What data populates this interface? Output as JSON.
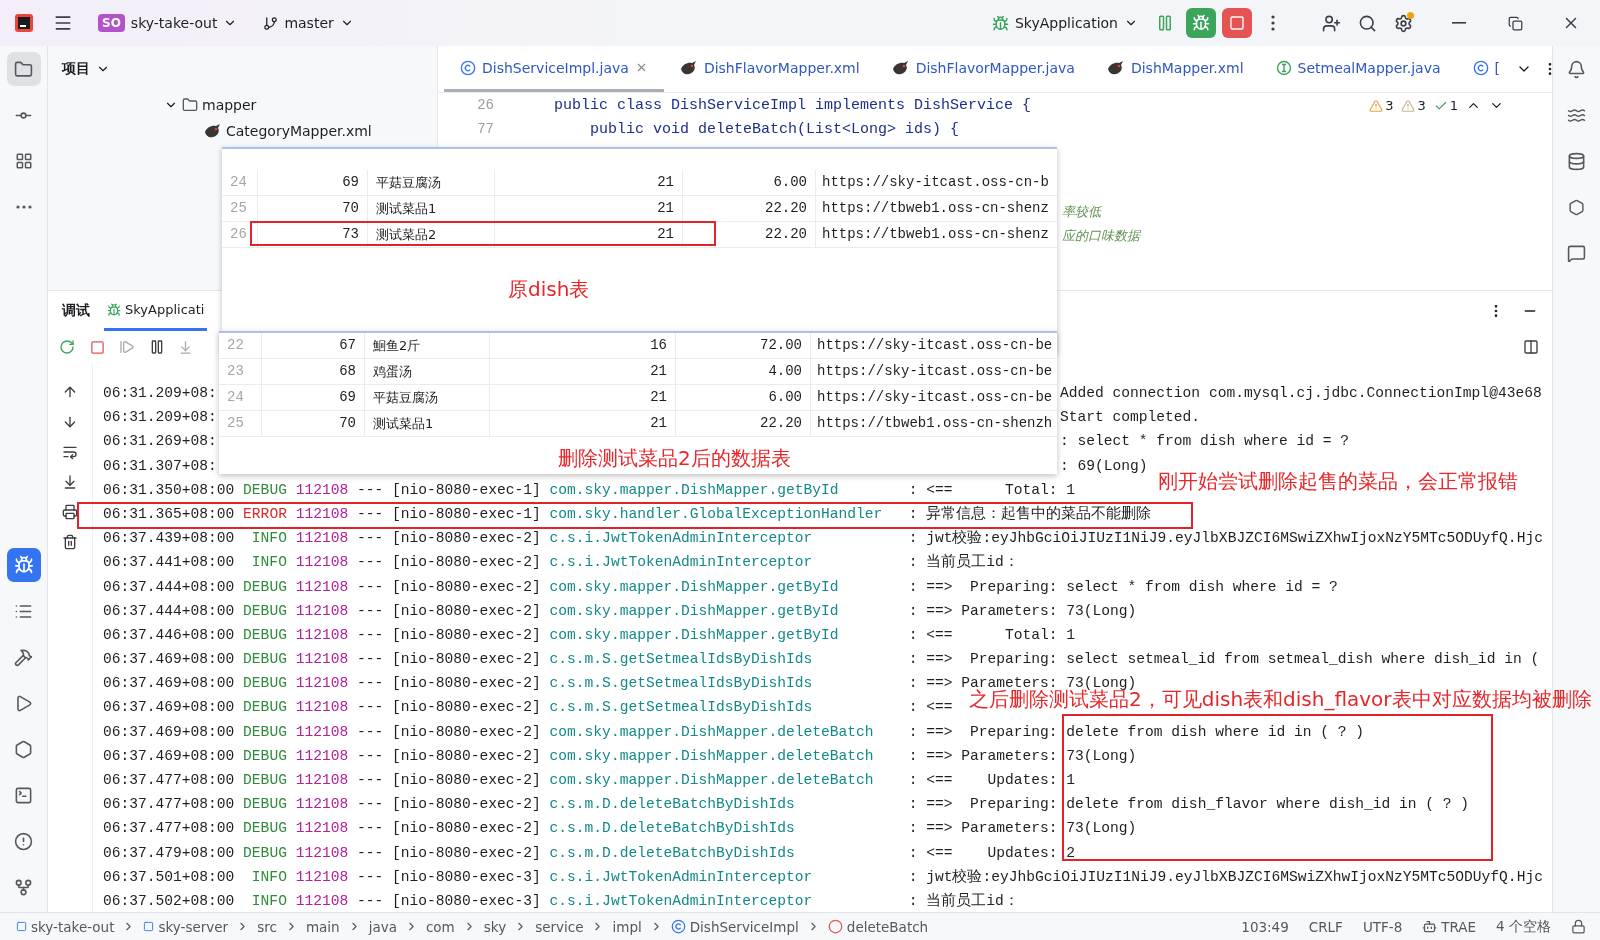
{
  "title_bar": {
    "project_badge": "SO",
    "project": "sky-take-out",
    "branch": "master",
    "run_config": "SkyApplication"
  },
  "project_panel": {
    "title": "项目",
    "tree": [
      {
        "label": "mapper",
        "expanded": true,
        "children": [
          {
            "label": "CategoryMapper.xml"
          }
        ]
      }
    ]
  },
  "editor": {
    "tabs": [
      {
        "label": "DishServiceImpl.java",
        "kind": "class",
        "selected": true
      },
      {
        "label": "DishFlavorMapper.xml",
        "kind": "xml",
        "selected": false
      },
      {
        "label": "DishFlavorMapper.java",
        "kind": "xml",
        "selected": false
      },
      {
        "label": "DishMapper.xml",
        "kind": "xml",
        "selected": false
      },
      {
        "label": "SetmealMapper.java",
        "kind": "interface",
        "selected": false
      },
      {
        "label": "[",
        "kind": "class",
        "selected": false
      }
    ],
    "inspections": [
      {
        "kind": "warning",
        "count": "3"
      },
      {
        "kind": "weak",
        "count": "3"
      },
      {
        "kind": "ok",
        "count": "1"
      }
    ],
    "lines": [
      {
        "number": "26",
        "code": "public class DishServiceImpl implements DishService {"
      },
      {
        "number": "77",
        "code": "    public void deleteBatch(List<Long> ids) {"
      }
    ],
    "comment_fragments": [
      "率较低",
      "应的口味数据"
    ]
  },
  "debug_panel": {
    "title": "调试",
    "tabs": [
      {
        "label": "SkyApplicati",
        "selected": true
      }
    ],
    "log": [
      {
        "kind": "partial",
        "time": "06:31.209+08:",
        "message": "Added connection com.mysql.cj.jdbc.ConnectionImpl@43e68"
      },
      {
        "kind": "partial",
        "time": "06:31.209+08:",
        "message": "Start completed."
      },
      {
        "kind": "partial",
        "time": "06:31.269+08:",
        "message": ": select * from dish where id = ?"
      },
      {
        "kind": "partial",
        "time": "06:31.307+08:",
        "message": ": 69(Long)"
      },
      {
        "kind": "full",
        "time": "06:31.350+08:00",
        "severity": "DEBUG",
        "color": "#2f8a3c",
        "pid": "112108",
        "thread": "--- [nio-8080-exec-1]",
        "logger": "com.sky.mapper.DishMapper.getById",
        "message": ": <==      Total: 1"
      },
      {
        "kind": "full",
        "time": "06:31.365+08:00",
        "severity": "ERROR",
        "color": "#e0282c",
        "pid": "112108",
        "thread": "--- [nio-8080-exec-1]",
        "logger": "com.sky.handler.GlobalExceptionHandler",
        "message": ": 异常信息：起售中的菜品不能删除"
      },
      {
        "kind": "full",
        "time": "06:37.439+08:00",
        "severity": "INFO",
        "color": "#2f8a3c",
        "pid": "112108",
        "thread": "--- [nio-8080-exec-2]",
        "logger": "c.s.i.JwtTokenAdminInterceptor",
        "message": ": jwt校验:eyJhbGciOiJIUzI1NiJ9.eyJlbXBJZCI6MSwiZXhwIjoxNzY5MTc5ODUyfQ.Hjc"
      },
      {
        "kind": "full",
        "time": "06:37.441+08:00",
        "severity": "INFO",
        "color": "#2f8a3c",
        "pid": "112108",
        "thread": "--- [nio-8080-exec-2]",
        "logger": "c.s.i.JwtTokenAdminInterceptor",
        "message": ": 当前员工id："
      },
      {
        "kind": "full",
        "time": "06:37.444+08:00",
        "severity": "DEBUG",
        "color": "#2f8a3c",
        "pid": "112108",
        "thread": "--- [nio-8080-exec-2]",
        "logger": "com.sky.mapper.DishMapper.getById",
        "message": ": ==>  Preparing: select * from dish where id = ?"
      },
      {
        "kind": "full",
        "time": "06:37.444+08:00",
        "severity": "DEBUG",
        "color": "#2f8a3c",
        "pid": "112108",
        "thread": "--- [nio-8080-exec-2]",
        "logger": "com.sky.mapper.DishMapper.getById",
        "message": ": ==> Parameters: 73(Long)"
      },
      {
        "kind": "full",
        "time": "06:37.446+08:00",
        "severity": "DEBUG",
        "color": "#2f8a3c",
        "pid": "112108",
        "thread": "--- [nio-8080-exec-2]",
        "logger": "com.sky.mapper.DishMapper.getById",
        "message": ": <==      Total: 1"
      },
      {
        "kind": "full",
        "time": "06:37.469+08:00",
        "severity": "DEBUG",
        "color": "#2f8a3c",
        "pid": "112108",
        "thread": "--- [nio-8080-exec-2]",
        "logger": "c.s.m.S.getSetmealIdsByDishIds",
        "message": ": ==>  Preparing: select setmeal_id from setmeal_dish where dish_id in ("
      },
      {
        "kind": "full",
        "time": "06:37.469+08:00",
        "severity": "DEBUG",
        "color": "#2f8a3c",
        "pid": "112108",
        "thread": "--- [nio-8080-exec-2]",
        "logger": "c.s.m.S.getSetmealIdsByDishIds",
        "message": ": ==> Parameters: 73(Long)"
      },
      {
        "kind": "full",
        "time": "06:37.469+08:00",
        "severity": "DEBUG",
        "color": "#2f8a3c",
        "pid": "112108",
        "thread": "--- [nio-8080-exec-2]",
        "logger": "c.s.m.S.getSetmealIdsByDishIds",
        "message": ": <=="
      },
      {
        "kind": "full",
        "time": "06:37.469+08:00",
        "severity": "DEBUG",
        "color": "#2f8a3c",
        "pid": "112108",
        "thread": "--- [nio-8080-exec-2]",
        "logger": "com.sky.mapper.DishMapper.deleteBatch",
        "message": ": ==>  Preparing: delete from dish where id in ( ? )"
      },
      {
        "kind": "full",
        "time": "06:37.469+08:00",
        "severity": "DEBUG",
        "color": "#2f8a3c",
        "pid": "112108",
        "thread": "--- [nio-8080-exec-2]",
        "logger": "com.sky.mapper.DishMapper.deleteBatch",
        "message": ": ==> Parameters: 73(Long)"
      },
      {
        "kind": "full",
        "time": "06:37.477+08:00",
        "severity": "DEBUG",
        "color": "#2f8a3c",
        "pid": "112108",
        "thread": "--- [nio-8080-exec-2]",
        "logger": "com.sky.mapper.DishMapper.deleteBatch",
        "message": ": <==    Updates: 1"
      },
      {
        "kind": "full",
        "time": "06:37.477+08:00",
        "severity": "DEBUG",
        "color": "#2f8a3c",
        "pid": "112108",
        "thread": "--- [nio-8080-exec-2]",
        "logger": "c.s.m.D.deleteBatchByDishIds",
        "message": ": ==>  Preparing: delete from dish_flavor where dish_id in ( ? )"
      },
      {
        "kind": "full",
        "time": "06:37.477+08:00",
        "severity": "DEBUG",
        "color": "#2f8a3c",
        "pid": "112108",
        "thread": "--- [nio-8080-exec-2]",
        "logger": "c.s.m.D.deleteBatchByDishIds",
        "message": ": ==> Parameters: 73(Long)"
      },
      {
        "kind": "full",
        "time": "06:37.479+08:00",
        "severity": "DEBUG",
        "color": "#2f8a3c",
        "pid": "112108",
        "thread": "--- [nio-8080-exec-2]",
        "logger": "c.s.m.D.deleteBatchByDishIds",
        "message": ": <==    Updates: 2"
      },
      {
        "kind": "full",
        "time": "06:37.501+08:00",
        "severity": "INFO",
        "color": "#2f8a3c",
        "pid": "112108",
        "thread": "--- [nio-8080-exec-3]",
        "logger": "c.s.i.JwtTokenAdminInterceptor",
        "message": ": jwt校验:eyJhbGciOiJIUzI1NiJ9.eyJlbXBJZCI6MSwiZXhwIjoxNzY5MTc5ODUyfQ.Hjc"
      },
      {
        "kind": "full",
        "time": "06:37.502+08:00",
        "severity": "INFO",
        "color": "#2f8a3c",
        "pid": "112108",
        "thread": "--- [nio-8080-exec-3]",
        "logger": "c.s.i.JwtTokenAdminInterceptor",
        "message": ": 当前员工id："
      }
    ]
  },
  "snapshots": [
    {
      "caption": "原dish表",
      "rows": [
        {
          "line": "24",
          "id": "69",
          "name": "平菇豆腐汤",
          "category": "21",
          "price": "6.00",
          "url": "https://sky-itcast.oss-cn-b",
          "highlighted": false
        },
        {
          "line": "25",
          "id": "70",
          "name": "测试菜品1",
          "category": "21",
          "price": "22.20",
          "url": "https://tbweb1.oss-cn-shenz",
          "highlighted": false
        },
        {
          "line": "26",
          "id": "73",
          "name": "测试菜品2",
          "category": "21",
          "price": "22.20",
          "url": "https://tbweb1.oss-cn-shenz",
          "highlighted": true
        }
      ]
    },
    {
      "caption": "删除测试菜品2后的数据表",
      "rows": [
        {
          "line": "22",
          "id": "67",
          "name": "鮰鱼2斤",
          "category": "16",
          "price": "72.00",
          "url": "https://sky-itcast.oss-cn-be",
          "highlighted": false
        },
        {
          "line": "23",
          "id": "68",
          "name": "鸡蛋汤",
          "category": "21",
          "price": "4.00",
          "url": "https://sky-itcast.oss-cn-be",
          "highlighted": false
        },
        {
          "line": "24",
          "id": "69",
          "name": "平菇豆腐汤",
          "category": "21",
          "price": "6.00",
          "url": "https://sky-itcast.oss-cn-be",
          "highlighted": false
        },
        {
          "line": "25",
          "id": "70",
          "name": "测试菜品1",
          "category": "21",
          "price": "22.20",
          "url": "https://tbweb1.oss-cn-shenzh",
          "highlighted": false
        }
      ]
    }
  ],
  "annotations": [
    {
      "text": "刚开始尝试删除起售的菜品，会正常报错"
    },
    {
      "text": "之后删除测试菜品2，可见dish表和dish_flavor表中对应数据均被删除"
    }
  ],
  "status_bar": {
    "breadcrumbs": [
      {
        "kind": "module",
        "label": "sky-take-out"
      },
      {
        "kind": "module",
        "label": "sky-server"
      },
      {
        "kind": "package",
        "label": "src"
      },
      {
        "kind": "package",
        "label": "main"
      },
      {
        "kind": "package",
        "label": "java"
      },
      {
        "kind": "package",
        "label": "com"
      },
      {
        "kind": "package",
        "label": "sky"
      },
      {
        "kind": "package",
        "label": "service"
      },
      {
        "kind": "package",
        "label": "impl"
      },
      {
        "kind": "class",
        "label": "DishServiceImpl"
      },
      {
        "kind": "method",
        "label": "deleteBatch"
      }
    ],
    "items": [
      {
        "kind": "text",
        "label": "103:49"
      },
      {
        "kind": "text",
        "label": "CRLF"
      },
      {
        "kind": "text",
        "label": "UTF-8"
      },
      {
        "kind": "ai",
        "label": "TRAE"
      },
      {
        "kind": "text",
        "label": "4 个空格"
      }
    ]
  }
}
